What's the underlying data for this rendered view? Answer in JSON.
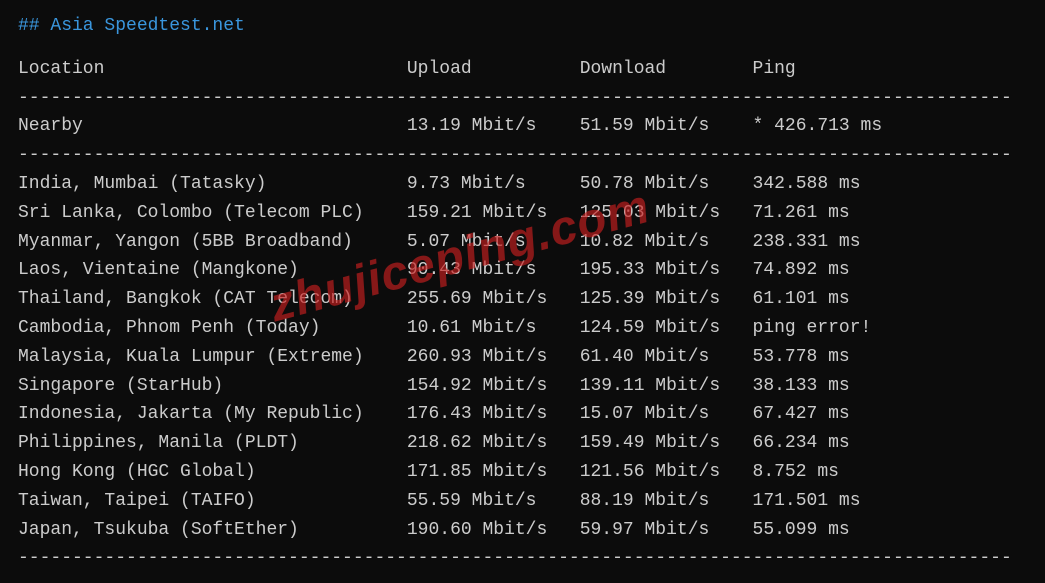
{
  "title": "## Asia Speedtest.net",
  "headers": {
    "location": "Location",
    "upload": "Upload",
    "download": "Download",
    "ping": "Ping"
  },
  "nearby": {
    "location": "Nearby",
    "upload": "13.19 Mbit/s",
    "download": "51.59 Mbit/s",
    "ping": "* 426.713 ms"
  },
  "rows": [
    {
      "location": "India, Mumbai (Tatasky)",
      "upload": "9.73 Mbit/s",
      "download": "50.78 Mbit/s",
      "ping": "342.588 ms"
    },
    {
      "location": "Sri Lanka, Colombo (Telecom PLC)",
      "upload": "159.21 Mbit/s",
      "download": "125.03 Mbit/s",
      "ping": "71.261 ms"
    },
    {
      "location": "Myanmar, Yangon (5BB Broadband)",
      "upload": "5.07 Mbit/s",
      "download": "10.82 Mbit/s",
      "ping": "238.331 ms"
    },
    {
      "location": "Laos, Vientaine (Mangkone)",
      "upload": "90.43 Mbit/s",
      "download": "195.33 Mbit/s",
      "ping": "74.892 ms"
    },
    {
      "location": "Thailand, Bangkok (CAT Telecom)",
      "upload": "255.69 Mbit/s",
      "download": "125.39 Mbit/s",
      "ping": "61.101 ms"
    },
    {
      "location": "Cambodia, Phnom Penh (Today)",
      "upload": "10.61 Mbit/s",
      "download": "124.59 Mbit/s",
      "ping": "ping error!"
    },
    {
      "location": "Malaysia, Kuala Lumpur (Extreme)",
      "upload": "260.93 Mbit/s",
      "download": "61.40 Mbit/s",
      "ping": "53.778 ms"
    },
    {
      "location": "Singapore (StarHub)",
      "upload": "154.92 Mbit/s",
      "download": "139.11 Mbit/s",
      "ping": "38.133 ms"
    },
    {
      "location": "Indonesia, Jakarta (My Republic)",
      "upload": "176.43 Mbit/s",
      "download": "15.07 Mbit/s",
      "ping": "67.427 ms"
    },
    {
      "location": "Philippines, Manila (PLDT)",
      "upload": "218.62 Mbit/s",
      "download": "159.49 Mbit/s",
      "ping": "66.234 ms"
    },
    {
      "location": "Hong Kong (HGC Global)",
      "upload": "171.85 Mbit/s",
      "download": "121.56 Mbit/s",
      "ping": "8.752 ms"
    },
    {
      "location": "Taiwan, Taipei (TAIFO)",
      "upload": "55.59 Mbit/s",
      "download": "88.19 Mbit/s",
      "ping": "171.501 ms"
    },
    {
      "location": "Japan, Tsukuba (SoftEther)",
      "upload": "190.60 Mbit/s",
      "download": "59.97 Mbit/s",
      "ping": "55.099 ms"
    }
  ],
  "watermark": "zhujiceping.com",
  "divider": "--------------------------------------------------------------------------------------------"
}
